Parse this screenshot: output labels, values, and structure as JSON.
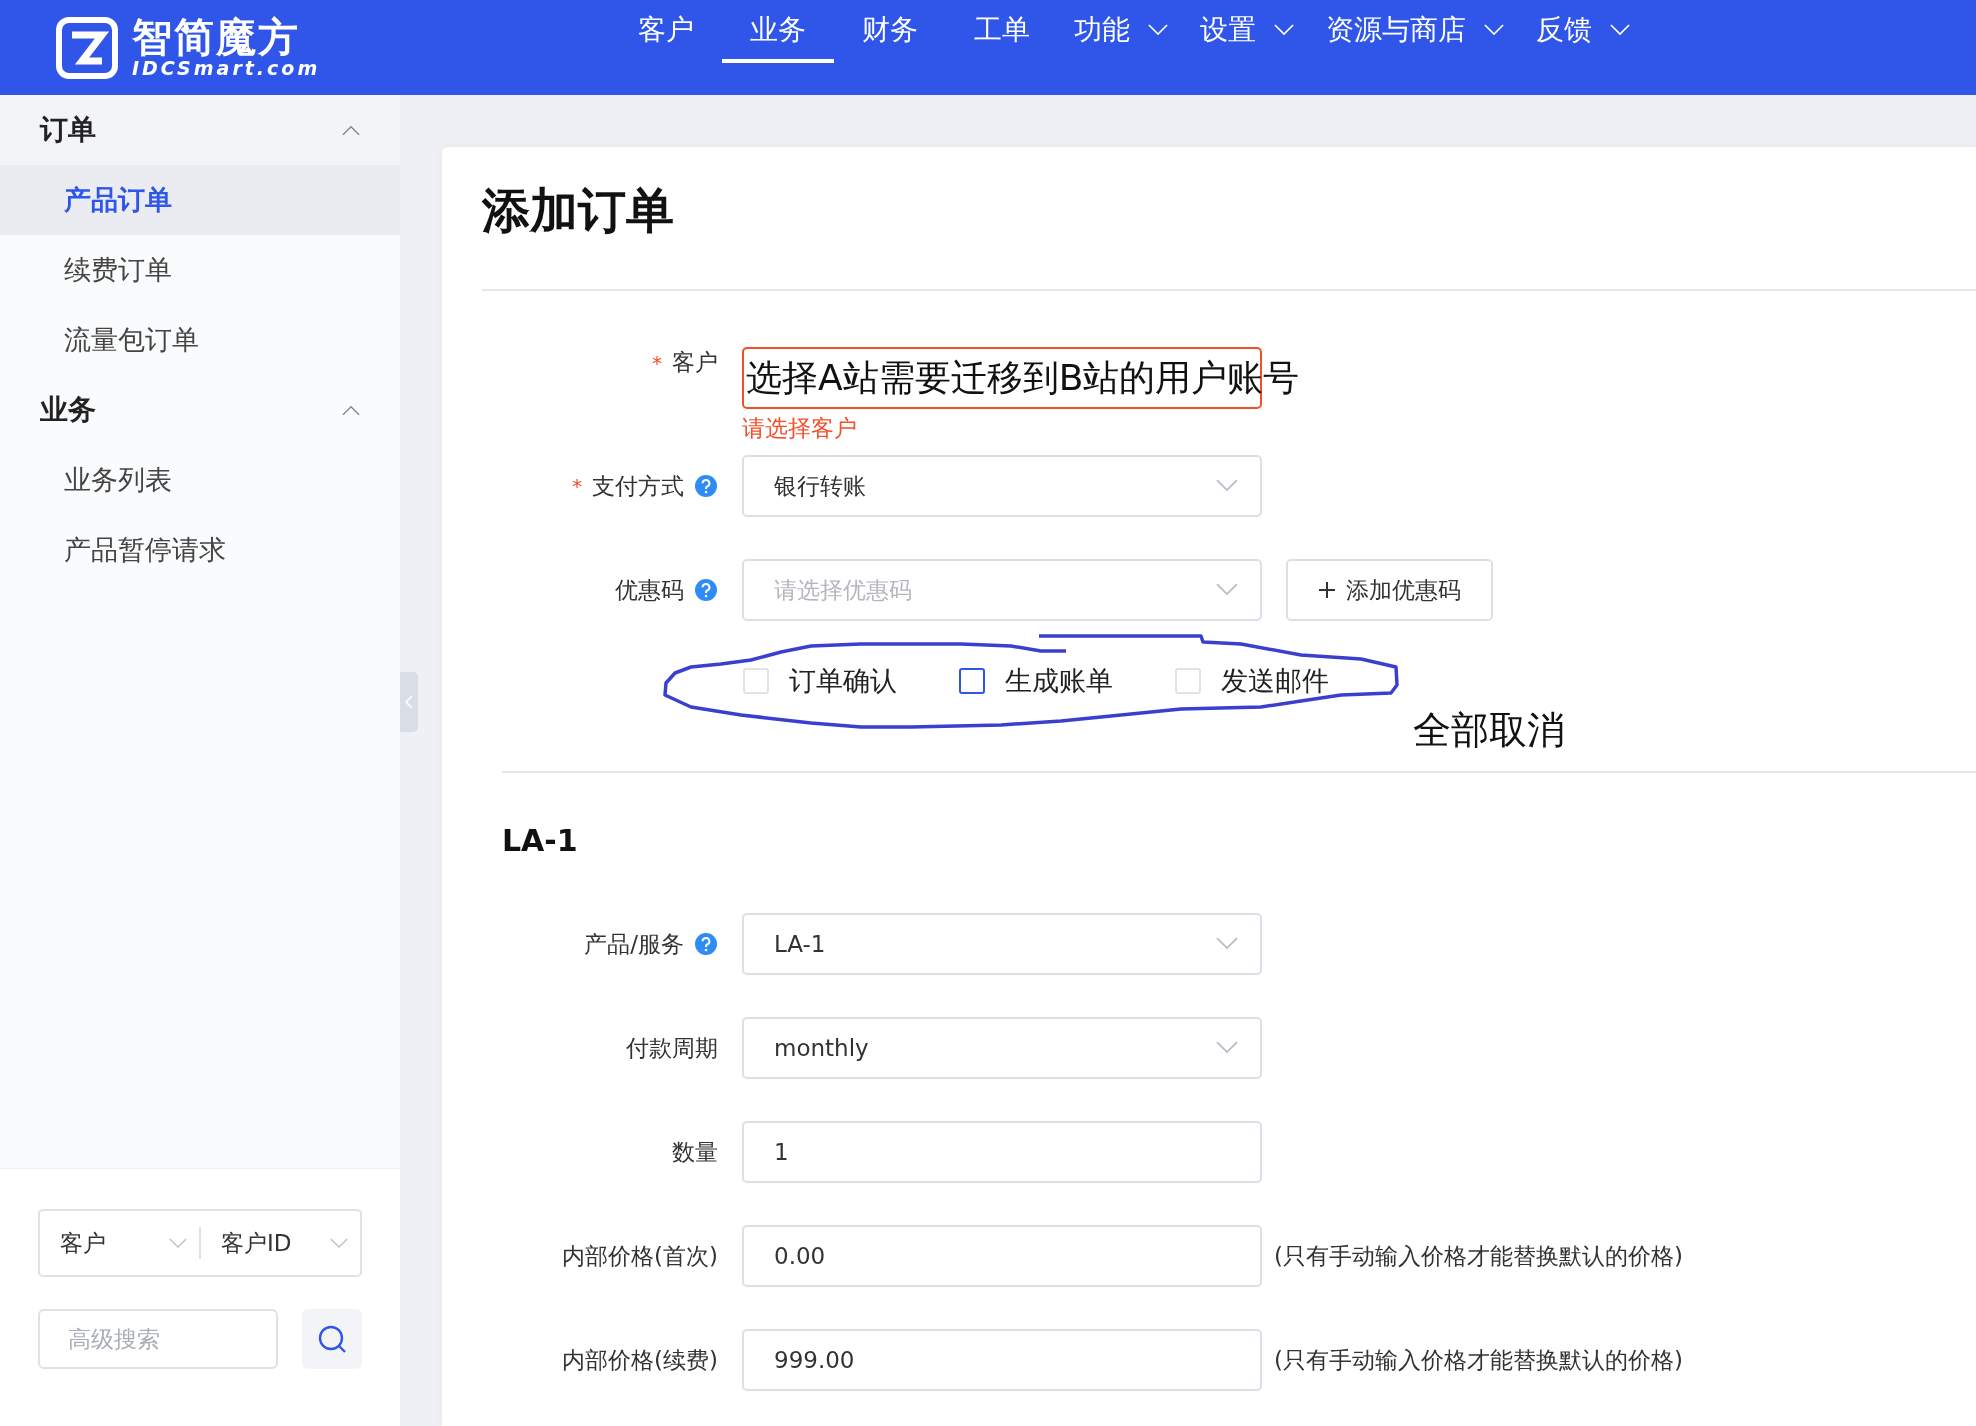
{
  "header": {
    "logo_title": "智简魔方",
    "logo_subtitle": "IDCSmart.com",
    "nav": [
      {
        "label": "客户",
        "selected": false,
        "dropdown": false
      },
      {
        "label": "业务",
        "selected": true,
        "dropdown": false
      },
      {
        "label": "财务",
        "selected": false,
        "dropdown": false
      },
      {
        "label": "工单",
        "selected": false,
        "dropdown": false
      },
      {
        "label": "功能",
        "selected": false,
        "dropdown": true
      },
      {
        "label": "设置",
        "selected": false,
        "dropdown": true
      },
      {
        "label": "资源与商店",
        "selected": false,
        "dropdown": true
      },
      {
        "label": "反馈",
        "selected": false,
        "dropdown": true
      }
    ]
  },
  "sidebar": {
    "groups": [
      {
        "title": "订单",
        "expanded": true,
        "items": [
          {
            "label": "产品订单",
            "selected": true
          },
          {
            "label": "续费订单",
            "selected": false
          },
          {
            "label": "流量包订单",
            "selected": false
          }
        ]
      },
      {
        "title": "业务",
        "expanded": true,
        "items": [
          {
            "label": "业务列表",
            "selected": false
          },
          {
            "label": "产品暂停请求",
            "selected": false
          }
        ]
      }
    ],
    "filter": {
      "type_select": "客户",
      "key_select": "客户ID",
      "search_placeholder": "高级搜索"
    }
  },
  "form": {
    "title": "添加订单",
    "fields": [
      {
        "kind": "customer",
        "label": "客户",
        "required_mark": "*",
        "help": false,
        "annotation_text": "选择A站需要迁移到B站的用户账号",
        "error": "请选择客户"
      },
      {
        "kind": "select",
        "label": "支付方式",
        "required_mark": "*",
        "help": true,
        "value": "银行转账"
      },
      {
        "kind": "select",
        "label": "优惠码",
        "help": true,
        "placeholder": "请选择优惠码",
        "button": "添加优惠码"
      }
    ],
    "checkboxes": [
      {
        "label": "订单确认",
        "checked": false,
        "focused": false
      },
      {
        "label": "生成账单",
        "checked": false,
        "focused": true
      },
      {
        "label": "发送邮件",
        "checked": false,
        "focused": false
      }
    ],
    "annotation": "全部取消",
    "section": {
      "title": "LA-1",
      "fields": [
        {
          "kind": "select",
          "label": "产品/服务",
          "help": true,
          "value": "LA-1"
        },
        {
          "kind": "select",
          "label": "付款周期",
          "help": false,
          "value": "monthly"
        },
        {
          "kind": "input",
          "label": "数量",
          "help": false,
          "value": "1"
        },
        {
          "kind": "input",
          "label": "内部价格(首次)",
          "help": false,
          "value": "0.00",
          "note": "(只有手动输入价格才能替换默认的价格)"
        },
        {
          "kind": "input",
          "label": "内部价格(续费)",
          "help": false,
          "value": "999.00",
          "note": "(只有手动输入价格才能替换默认的价格)"
        }
      ]
    }
  }
}
